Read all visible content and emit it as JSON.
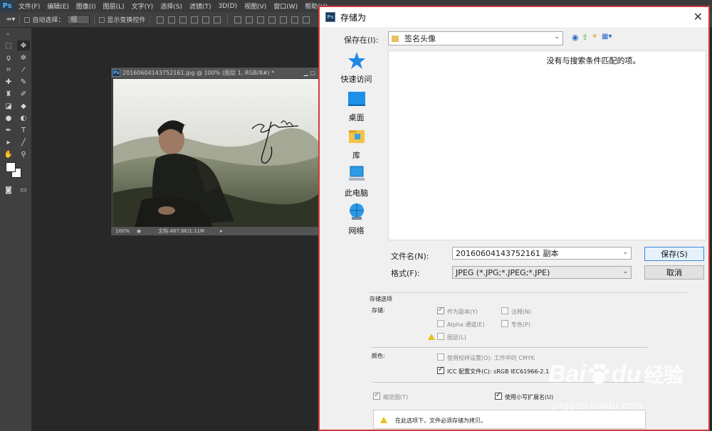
{
  "menubar": {
    "logo": "Ps",
    "items": [
      "文件(F)",
      "编辑(E)",
      "图像(I)",
      "图层(L)",
      "文字(Y)",
      "选择(S)",
      "滤镜(T)",
      "3D(D)",
      "视图(V)",
      "窗口(W)",
      "帮助(H)"
    ]
  },
  "optbar": {
    "auto_select_label": "自动选择：",
    "auto_select_value": "组",
    "show_transform_label": "显示变换控件"
  },
  "document": {
    "title": "20160604143752161.jpg @ 100% (图层 1, RGB/8#) *",
    "zoom": "100%",
    "doc_info": "文档:487.8K/1.11M"
  },
  "dialog": {
    "title": "存储为",
    "save_in_label": "保存在(I):",
    "save_in_value": "签名头像",
    "empty_message": "没有与搜索条件匹配的项。",
    "places": [
      {
        "label": "快速访问",
        "icon": "star-icon"
      },
      {
        "label": "桌面",
        "icon": "desktop-icon"
      },
      {
        "label": "库",
        "icon": "library-icon"
      },
      {
        "label": "此电脑",
        "icon": "computer-icon"
      },
      {
        "label": "网络",
        "icon": "network-icon"
      }
    ],
    "filename_label": "文件名(N):",
    "filename_value": "20160604143752161 副本",
    "format_label": "格式(F):",
    "format_value": "JPEG (*.JPG;*.JPEG;*.JPE)",
    "save_button": "保存(S)",
    "cancel_button": "取消",
    "options": {
      "heading": "存储选项",
      "save_group": "存储:",
      "as_copy": "作为副本(Y)",
      "annotations": "注释(N)",
      "alpha": "Alpha 通道(E)",
      "spot": "专色(P)",
      "layers": "图层(L)",
      "color_group": "颜色:",
      "proof": "使用校样设置(O): 工作中的 CMYK",
      "icc": "ICC 配置文件(C): sRGB IEC61966-2.1",
      "thumbnail": "缩览图(T)",
      "lowercase_ext": "使用小写扩展名(U)",
      "warning": "在此选项下，文件必须存储为拷贝。"
    }
  },
  "watermark": {
    "brand": "Bai",
    "brand2": "du",
    "brand_cn": "经验",
    "url": "jingyan.baidu.com"
  },
  "colors": {
    "accent": "#d23b3b",
    "ps_blue": "#4eb4ff"
  }
}
